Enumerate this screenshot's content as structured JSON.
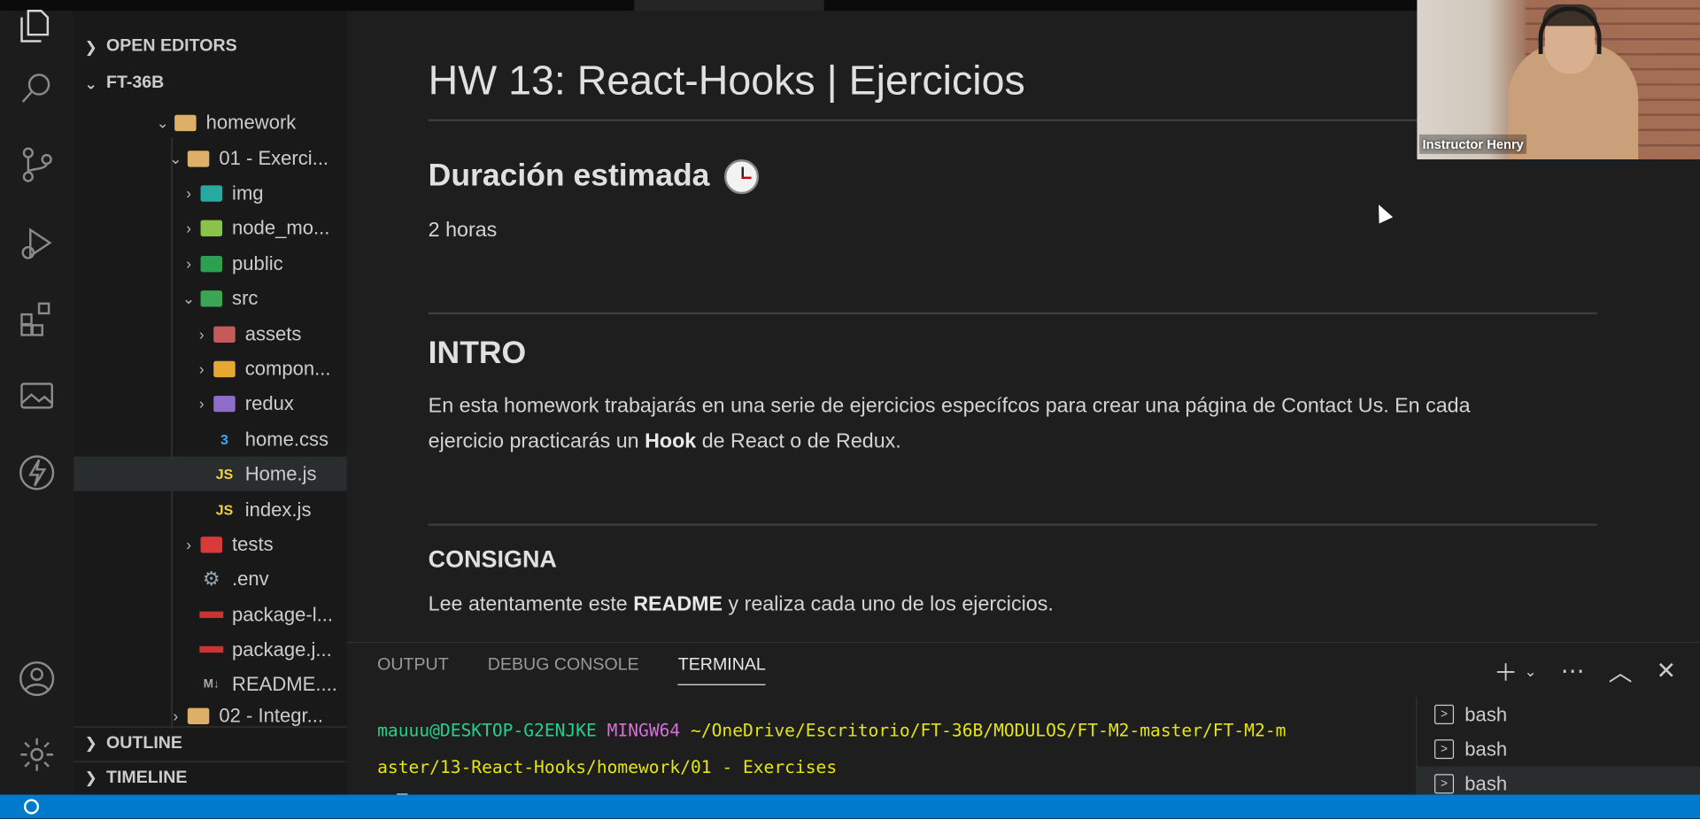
{
  "sidebar": {
    "sections": {
      "open_editors": "OPEN EDITORS",
      "project": "FT-36B",
      "outline": "OUTLINE",
      "timeline": "TIMELINE"
    },
    "tree": {
      "homework": "homework",
      "exercises": "01 - Exerci...",
      "img": "img",
      "node_modules": "node_mo...",
      "public": "public",
      "src": "src",
      "assets": "assets",
      "components": "compon...",
      "redux": "redux",
      "home_css": "home.css",
      "home_js": "Home.js",
      "index_js": "index.js",
      "tests": "tests",
      "env": ".env",
      "package_lock": "package-l...",
      "package_json": "package.j...",
      "readme": "README....",
      "integration": "02 - Integr..."
    },
    "icon_labels": {
      "js": "JS",
      "css": "3",
      "md": "M↓"
    }
  },
  "preview": {
    "title": "HW 13: React-Hooks | Ejercicios",
    "duration_heading": "Duración estimada",
    "duration_value": "2 horas",
    "intro_heading": "INTRO",
    "intro_text_1": "En esta homework trabajarás en una serie de ejercicios específcos para crear una página de Contact Us. En cada",
    "intro_text_2a": "ejercicio practicarás un ",
    "intro_text_2b": "Hook",
    "intro_text_2c": " de React o de Redux.",
    "consigna_heading": "CONSIGNA",
    "consigna_text_a": "Lee atentamente este ",
    "consigna_text_b": "README",
    "consigna_text_c": " y realiza cada uno de los ejercicios."
  },
  "panel": {
    "tabs": [
      "OUTPUT",
      "DEBUG CONSOLE",
      "TERMINAL"
    ],
    "active_tab": "TERMINAL",
    "terminal": {
      "user": "mauuu@DESKTOP-G2ENJKE",
      "shell": "MINGW64",
      "path_1": "~/OneDrive/Escritorio/FT-36B/MODULOS/FT-M2-master/FT-M2-m",
      "path_2": "aster/13-React-Hooks/homework/01 - Exercises",
      "prompt": "$"
    },
    "terminals": [
      "bash",
      "bash",
      "bash"
    ]
  },
  "webcam": {
    "name": "Instructor Henry"
  },
  "colors": {
    "accent": "#007acc",
    "terminal_user": "#23d18b",
    "terminal_shell": "#d670d6",
    "terminal_path": "#e5e510"
  }
}
